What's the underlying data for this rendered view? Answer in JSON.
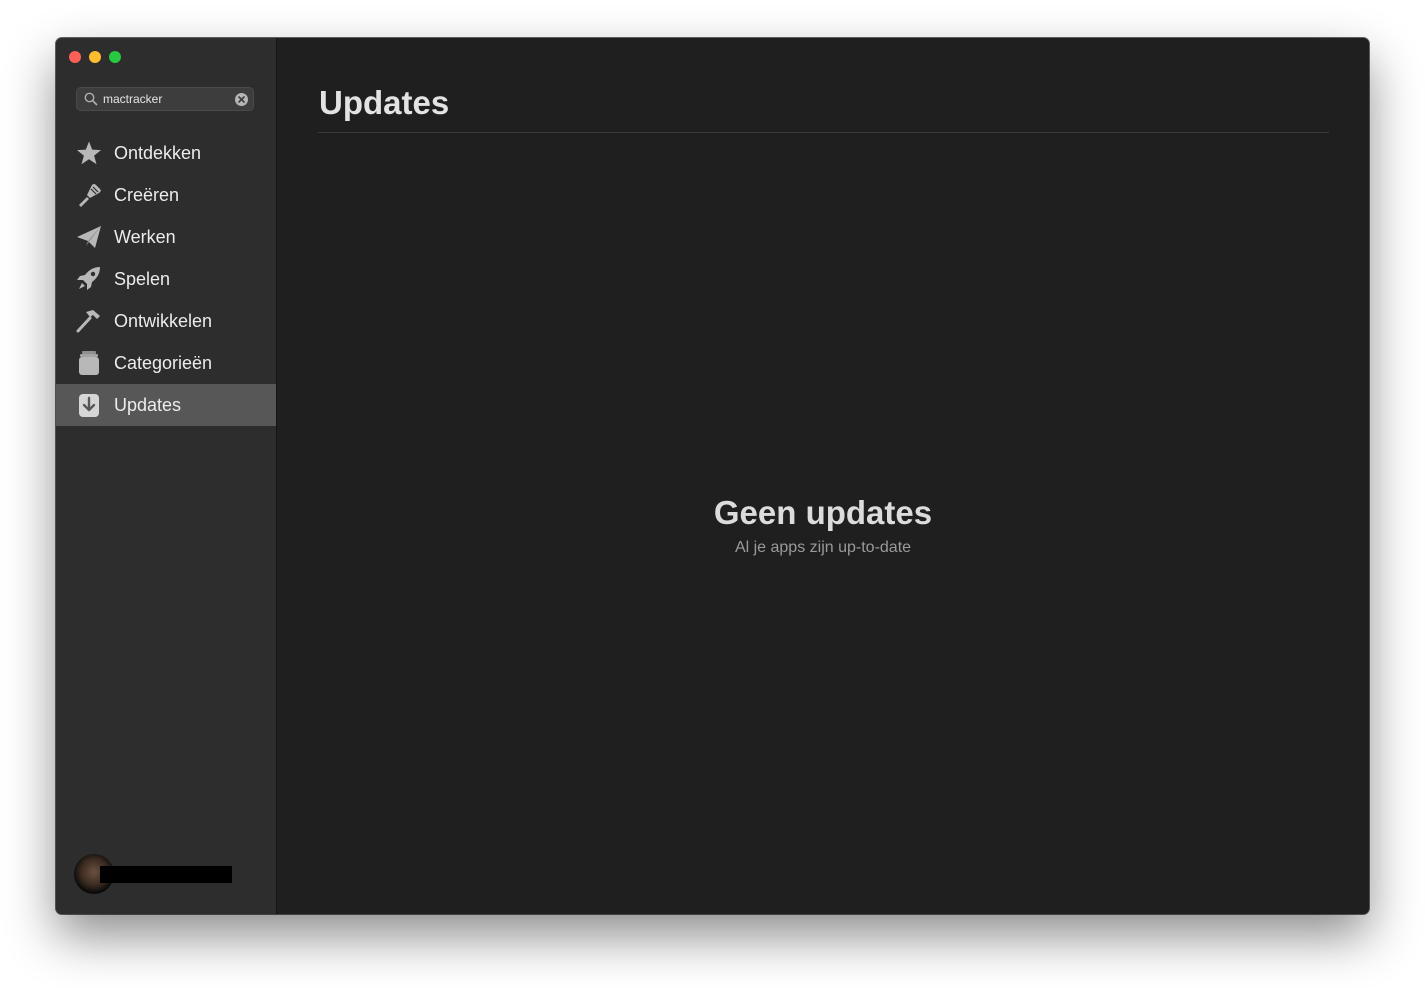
{
  "window": {
    "traffic_lights": {
      "close_color": "#fe5f57",
      "minimize_color": "#febc2e",
      "zoom_color": "#28c840"
    }
  },
  "sidebar": {
    "search": {
      "value": "mactracker",
      "icon": "search-icon",
      "clear_icon": "clear-icon"
    },
    "items": [
      {
        "label": "Ontdekken",
        "icon": "star-icon",
        "active": false
      },
      {
        "label": "Creëren",
        "icon": "brush-icon",
        "active": false
      },
      {
        "label": "Werken",
        "icon": "paper-plane-icon",
        "active": false
      },
      {
        "label": "Spelen",
        "icon": "rocket-icon",
        "active": false
      },
      {
        "label": "Ontwikkelen",
        "icon": "hammer-icon",
        "active": false
      },
      {
        "label": "Categorieën",
        "icon": "stack-icon",
        "active": false
      },
      {
        "label": "Updates",
        "icon": "updates-icon",
        "active": true
      }
    ],
    "active_color": "#575757"
  },
  "main": {
    "title": "Updates",
    "empty_state": {
      "title": "Geen updates",
      "subtitle": "Al je apps zijn up-to-date"
    }
  }
}
